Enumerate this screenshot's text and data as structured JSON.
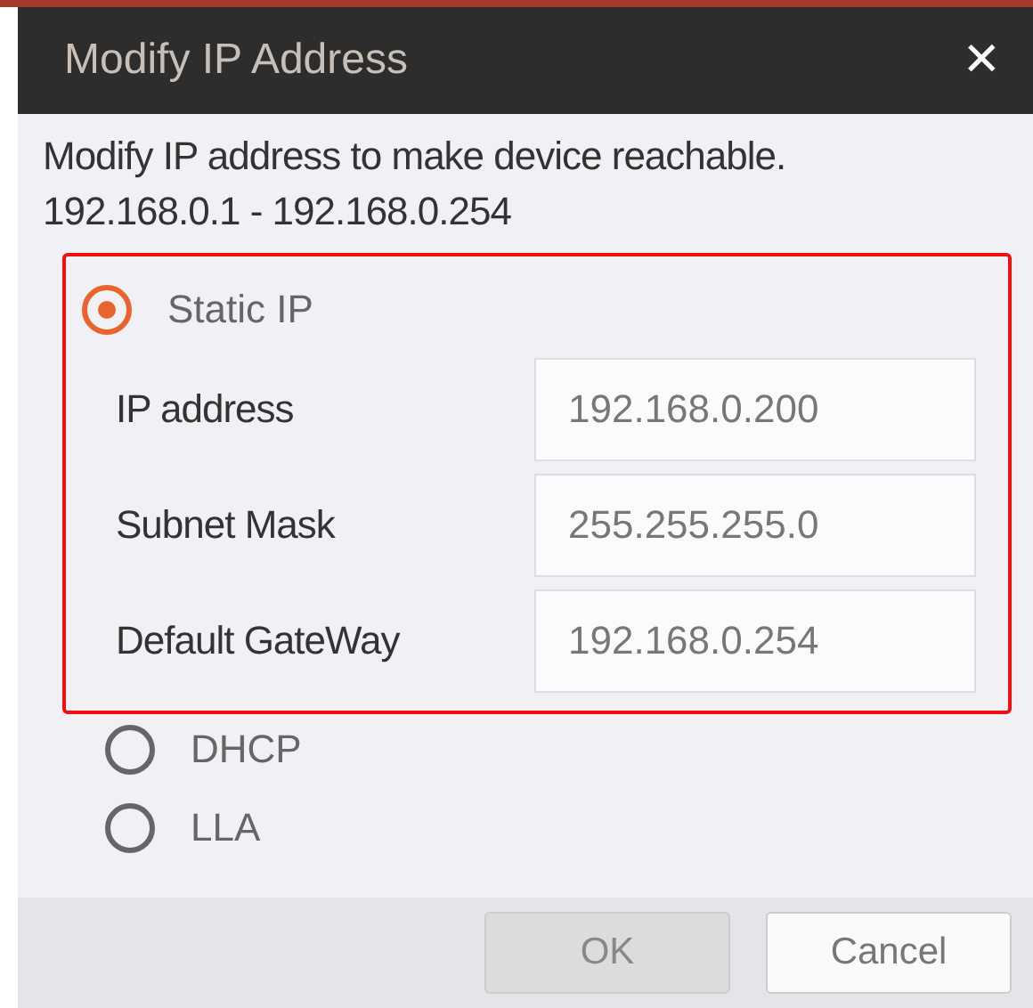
{
  "window": {
    "title": "Modify IP Address",
    "close": "✕"
  },
  "description": "Modify IP address to make device reachable.",
  "range": "192.168.0.1 - 192.168.0.254",
  "options": [
    {
      "label": "Static IP",
      "selected": true,
      "fields": [
        {
          "label": "IP address",
          "value": "192.168.0.200"
        },
        {
          "label": "Subnet Mask",
          "value": "255.255.255.0"
        },
        {
          "label": "Default GateWay",
          "value": "192.168.0.254"
        }
      ]
    },
    {
      "label": "DHCP",
      "selected": false
    },
    {
      "label": "LLA",
      "selected": false
    }
  ],
  "buttons": [
    {
      "label": "OK",
      "disabled": true
    },
    {
      "label": "Cancel",
      "disabled": false
    }
  ]
}
